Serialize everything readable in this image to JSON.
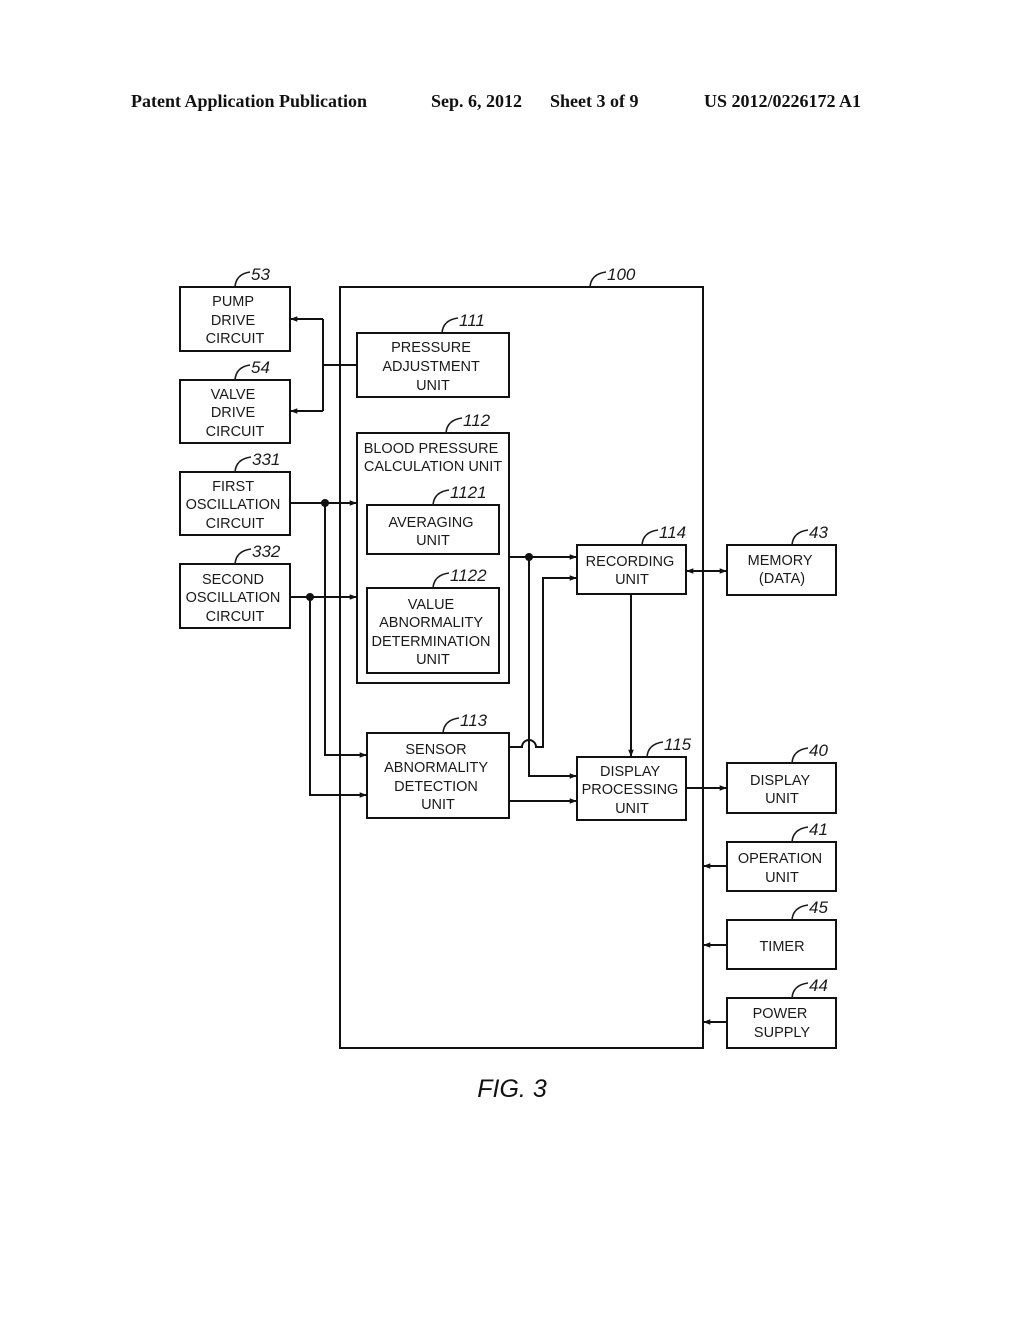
{
  "header": {
    "publication_type": "Patent Application Publication",
    "date": "Sep. 6, 2012",
    "sheet": "Sheet 3 of 9",
    "number": "US 2012/0226172 A1"
  },
  "figure_label": "FIG. 3",
  "blocks": {
    "b100": {
      "ref": "100"
    },
    "b53": {
      "ref": "53",
      "lines": [
        "PUMP",
        "DRIVE",
        "CIRCUIT"
      ]
    },
    "b54": {
      "ref": "54",
      "lines": [
        "VALVE",
        "DRIVE",
        "CIRCUIT"
      ]
    },
    "b331": {
      "ref": "331",
      "lines": [
        "FIRST",
        "OSCILLATION",
        "CIRCUIT"
      ]
    },
    "b332": {
      "ref": "332",
      "lines": [
        "SECOND",
        "OSCILLATION",
        "CIRCUIT"
      ]
    },
    "b111": {
      "ref": "111",
      "lines": [
        "PRESSURE",
        "ADJUSTMENT",
        "UNIT"
      ]
    },
    "b112": {
      "ref": "112",
      "lines": [
        "BLOOD PRESSURE",
        "CALCULATION UNIT"
      ]
    },
    "b1121": {
      "ref": "1121",
      "lines": [
        "AVERAGING",
        "UNIT"
      ]
    },
    "b1122": {
      "ref": "1122",
      "lines": [
        "VALUE",
        "ABNORMALITY",
        "DETERMINATION",
        "UNIT"
      ]
    },
    "b113": {
      "ref": "113",
      "lines": [
        "SENSOR",
        "ABNORMALITY",
        "DETECTION",
        "UNIT"
      ]
    },
    "b114": {
      "ref": "114",
      "lines": [
        "RECORDING",
        "UNIT"
      ]
    },
    "b115": {
      "ref": "115",
      "lines": [
        "DISPLAY",
        "PROCESSING",
        "UNIT"
      ]
    },
    "b43": {
      "ref": "43",
      "lines": [
        "MEMORY",
        "(DATA)"
      ]
    },
    "b40": {
      "ref": "40",
      "lines": [
        "DISPLAY",
        "UNIT"
      ]
    },
    "b41": {
      "ref": "41",
      "lines": [
        "OPERATION",
        "UNIT"
      ]
    },
    "b45": {
      "ref": "45",
      "lines": [
        "TIMER"
      ]
    },
    "b44": {
      "ref": "44",
      "lines": [
        "POWER",
        "SUPPLY"
      ]
    }
  },
  "connections": [
    {
      "from": "111",
      "to": "53"
    },
    {
      "from": "111",
      "to": "54"
    },
    {
      "from": "331",
      "to": "112"
    },
    {
      "from": "332",
      "to": "112"
    },
    {
      "from": "331",
      "to": "113"
    },
    {
      "from": "332",
      "to": "113"
    },
    {
      "from": "112",
      "to": "114"
    },
    {
      "from": "112",
      "to": "115"
    },
    {
      "from": "113",
      "to": "114"
    },
    {
      "from": "113",
      "to": "115"
    },
    {
      "from": "114",
      "to": "115"
    },
    {
      "from": "114",
      "to": "43",
      "bidirectional": true
    },
    {
      "from": "115",
      "to": "40"
    },
    {
      "from": "41",
      "to": "100"
    },
    {
      "from": "45",
      "to": "100"
    },
    {
      "from": "44",
      "to": "100"
    }
  ]
}
